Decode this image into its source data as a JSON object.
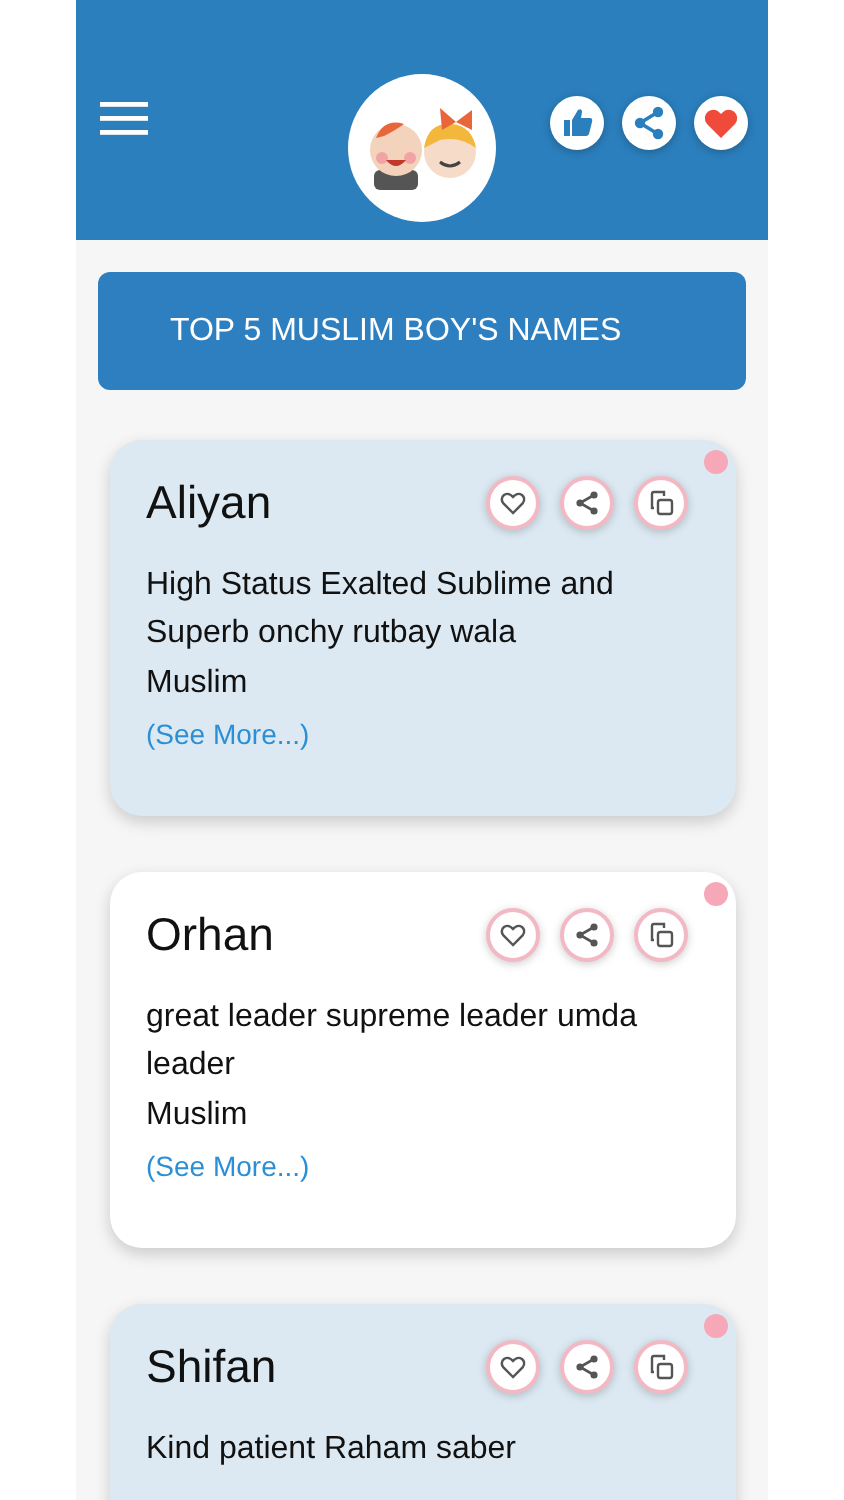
{
  "banner": {
    "title": "TOP 5 MUSLIM BOY'S NAMES"
  },
  "names": [
    {
      "name": "Aliyan",
      "meaning": "High Status Exalted Sublime and Superb onchy rutbay wala",
      "religion": "Muslim",
      "more": "(See More...)",
      "tinted": true
    },
    {
      "name": "Orhan",
      "meaning": "great leader supreme leader umda leader",
      "religion": "Muslim",
      "more": "(See More...)",
      "tinted": false
    },
    {
      "name": "Shifan",
      "meaning": "Kind patient Raham saber",
      "tinted": true
    }
  ]
}
